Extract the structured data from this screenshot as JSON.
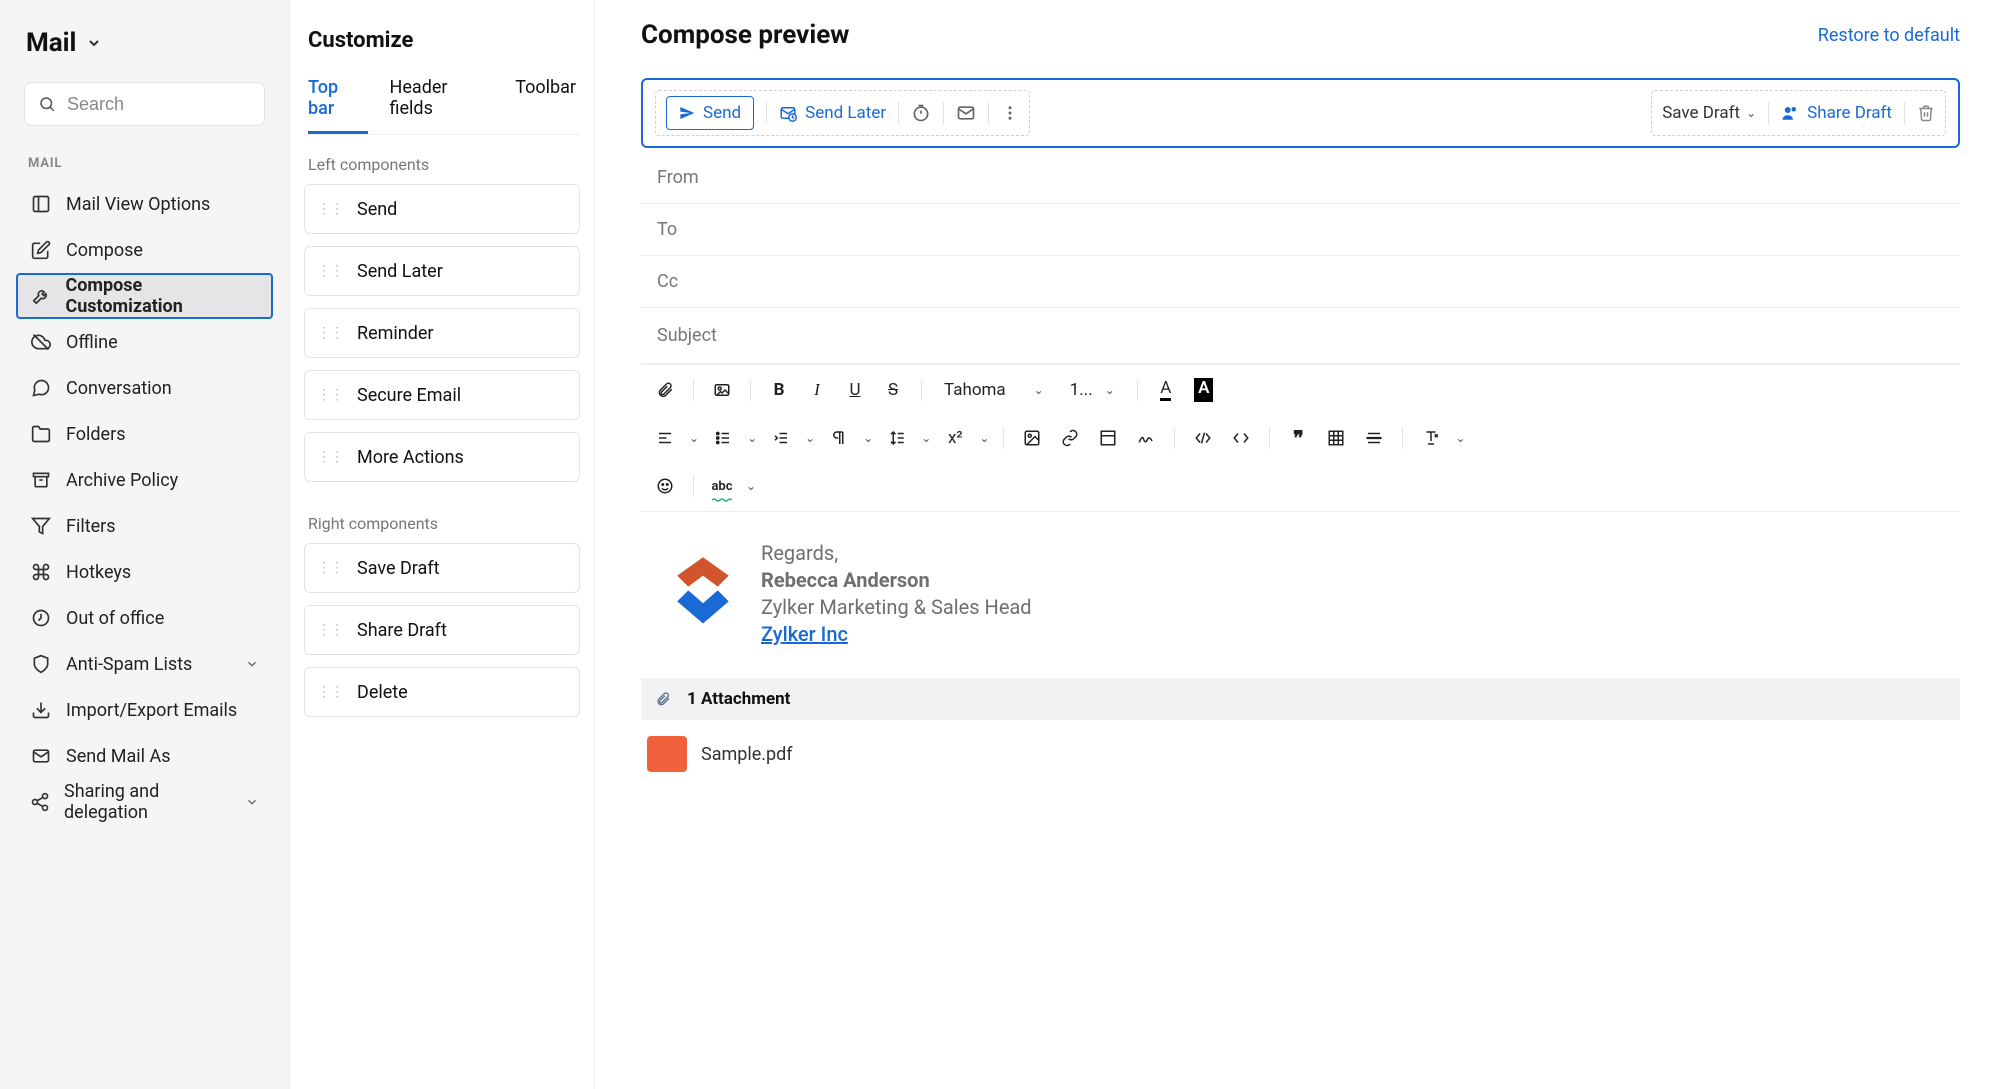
{
  "sidebar": {
    "title": "Mail",
    "search_placeholder": "Search",
    "section_label": "MAIL",
    "items": [
      {
        "label": "Mail View Options",
        "icon": "layout-icon"
      },
      {
        "label": "Compose",
        "icon": "compose-icon"
      },
      {
        "label": "Compose Customization",
        "icon": "tools-icon",
        "active": true
      },
      {
        "label": "Offline",
        "icon": "cloud-off-icon"
      },
      {
        "label": "Conversation",
        "icon": "chat-icon"
      },
      {
        "label": "Folders",
        "icon": "folder-icon"
      },
      {
        "label": "Archive Policy",
        "icon": "archive-icon"
      },
      {
        "label": "Filters",
        "icon": "filter-icon"
      },
      {
        "label": "Hotkeys",
        "icon": "command-icon"
      },
      {
        "label": "Out of office",
        "icon": "out-icon"
      },
      {
        "label": "Anti-Spam Lists",
        "icon": "shield-icon",
        "chevron": true
      },
      {
        "label": "Import/Export Emails",
        "icon": "import-icon"
      },
      {
        "label": "Send Mail As",
        "icon": "send-as-icon"
      },
      {
        "label": "Sharing and delegation",
        "icon": "share-icon",
        "chevron": true
      }
    ]
  },
  "customize": {
    "title": "Customize",
    "tabs": [
      "Top bar",
      "Header fields",
      "Toolbar"
    ],
    "active_tab": 0,
    "left_label": "Left components",
    "left_items": [
      "Send",
      "Send Later",
      "Reminder",
      "Secure Email",
      "More Actions"
    ],
    "right_label": "Right components",
    "right_items": [
      "Save Draft",
      "Share Draft",
      "Delete"
    ]
  },
  "preview": {
    "title": "Compose preview",
    "restore": "Restore to default",
    "topbar": {
      "send": "Send",
      "send_later": "Send Later",
      "save_draft": "Save Draft",
      "share_draft": "Share Draft"
    },
    "fields": [
      "From",
      "To",
      "Cc",
      "Subject"
    ],
    "toolbar": {
      "font": "Tahoma",
      "size": "1..."
    },
    "signature": {
      "regards": "Regards,",
      "name": "Rebecca Anderson",
      "role": "Zylker Marketing & Sales Head",
      "link": "Zylker Inc"
    },
    "attachment": {
      "count_label": "1 Attachment",
      "file": "Sample.pdf"
    }
  }
}
